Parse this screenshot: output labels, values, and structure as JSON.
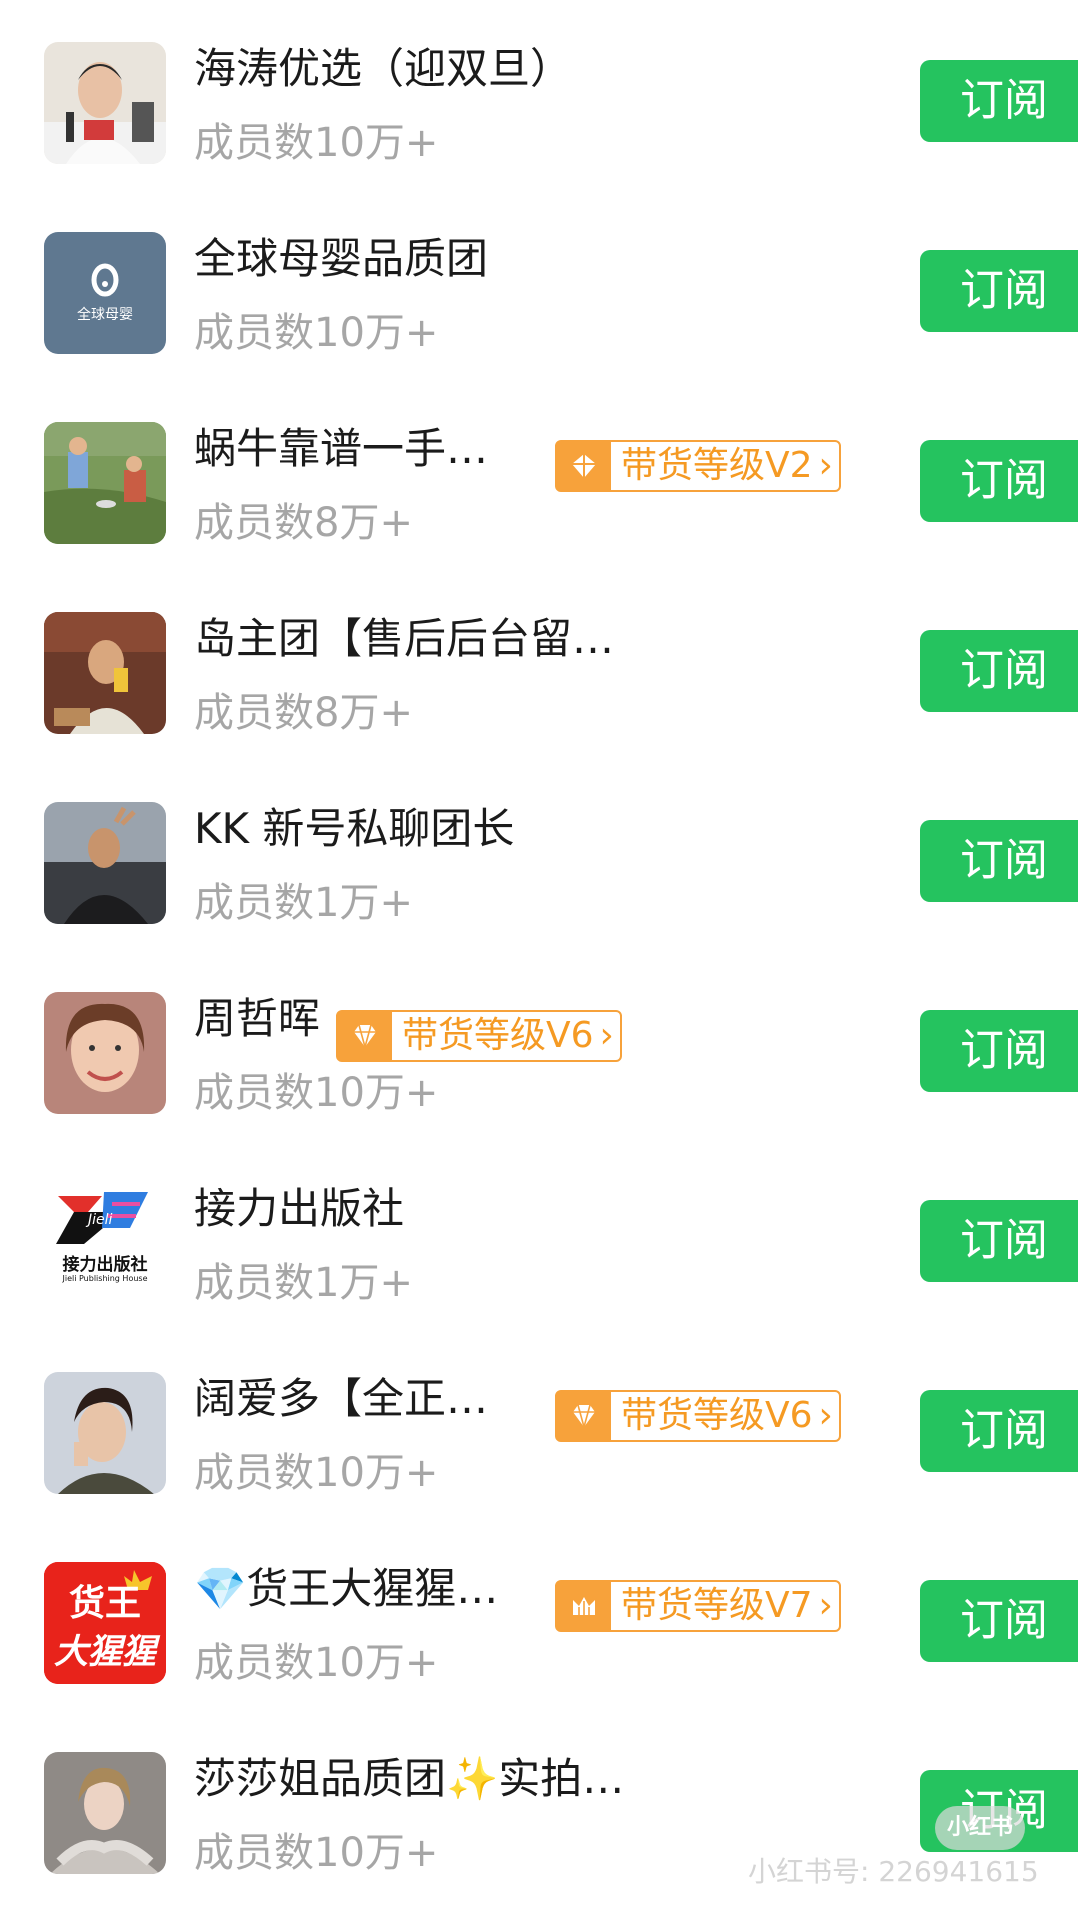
{
  "subscribe_label": "订阅",
  "rows": [
    {
      "name": "海涛优选（迎双旦）",
      "count": "成员数10万+",
      "badge": null
    },
    {
      "name": "全球母婴品质团",
      "count": "成员数10万+",
      "badge": null,
      "logo_text": "全球母婴"
    },
    {
      "name": "蜗牛靠谱一手…",
      "count": "成员数8万+",
      "badge": "带货等级V2",
      "badge_icon": "diamond-icon"
    },
    {
      "name": "岛主团【售后后台留…",
      "count": "成员数8万+",
      "badge": null
    },
    {
      "name": "KK 新号私聊团长",
      "count": "成员数1万+",
      "badge": null
    },
    {
      "name": "周哲晖",
      "count": "成员数10万+",
      "badge": "带货等级V6",
      "badge_icon": "gem-icon"
    },
    {
      "name": "接力出版社",
      "count": "成员数1万+",
      "badge": null,
      "logo_text": "接力出版社",
      "logo_sub": "Jieli Publishing House",
      "logo_word": "Jieli"
    },
    {
      "name": "阔爱多【全正…",
      "count": "成员数10万+",
      "badge": "带货等级V6",
      "badge_icon": "gem-icon"
    },
    {
      "name": "💎货王大猩猩…",
      "count": "成员数10万+",
      "badge": "带货等级V7",
      "badge_icon": "crown-icon",
      "logo_text": "货王",
      "logo_text2": "大猩猩"
    },
    {
      "name": "莎莎姐品质团✨实拍…",
      "count": "成员数10万+",
      "badge": null
    }
  ],
  "watermark": {
    "logo": "小红书",
    "text": "小红书号: 226941615"
  },
  "colors": {
    "accent_green": "#25c35f",
    "badge_orange": "#f7a23b",
    "muted_text": "#a6a6a6"
  }
}
